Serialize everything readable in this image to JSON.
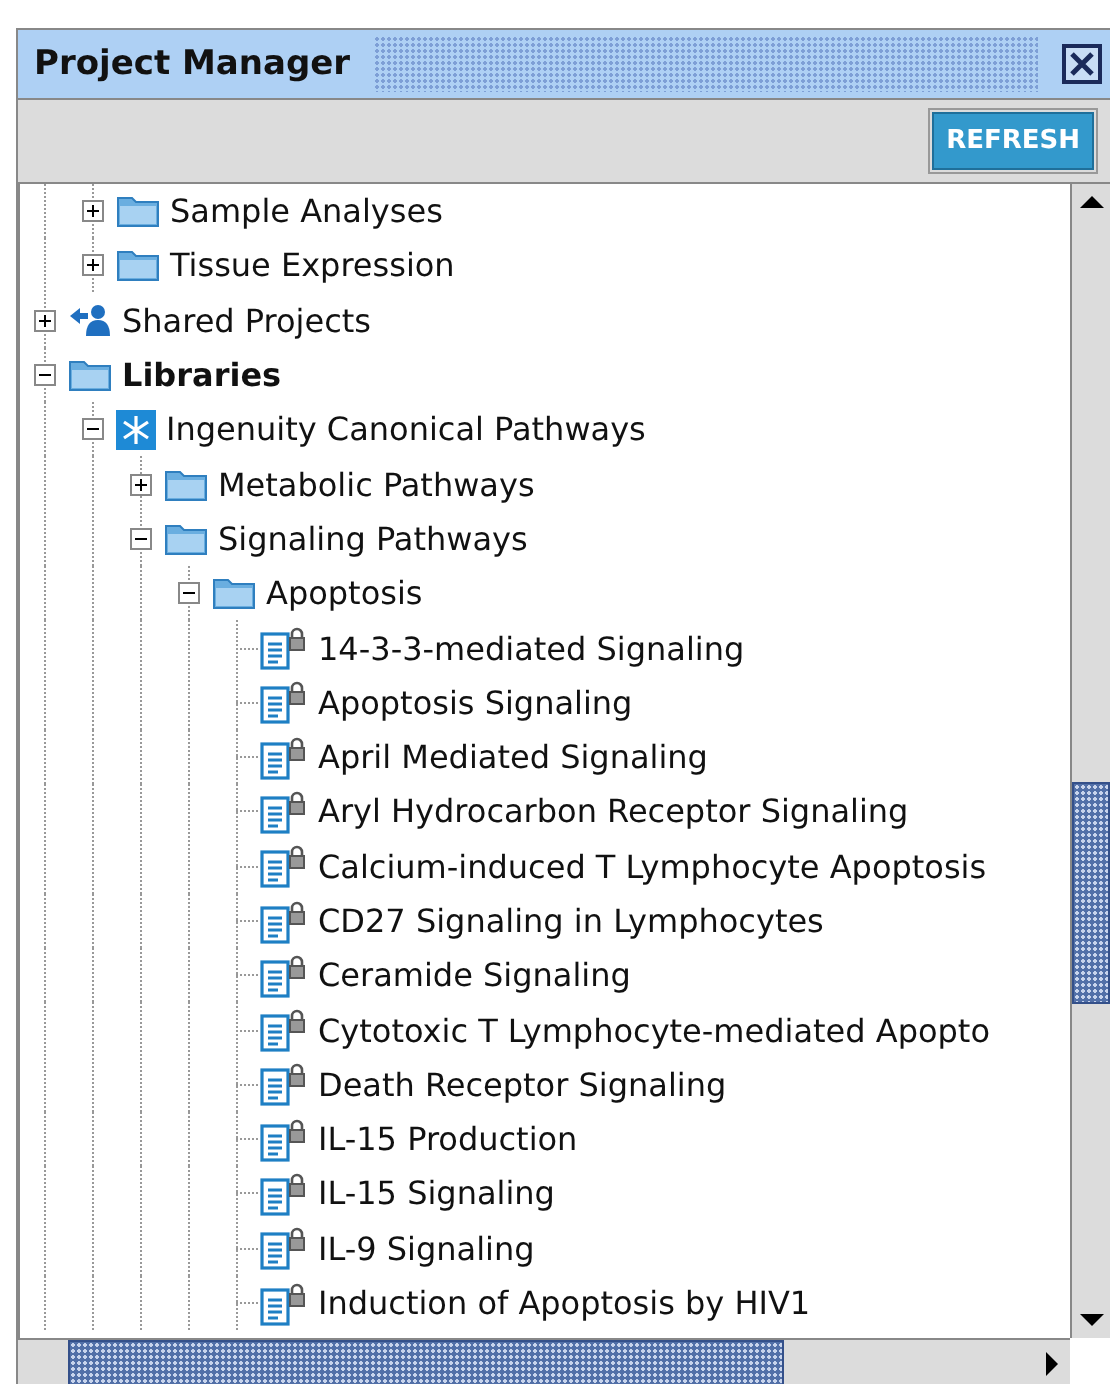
{
  "window": {
    "title": "Project Manager"
  },
  "toolbar": {
    "buttons": [
      "REFRESH"
    ]
  },
  "tree": [
    {
      "children": [
        {
          "label": "Sample Analyses",
          "kind": "folder",
          "expanded": false
        },
        {
          "label": "Tissue Expression",
          "kind": "folder",
          "expanded": false
        }
      ]
    },
    {
      "label": "Shared Projects",
      "kind": "shared",
      "expanded": false
    },
    {
      "label": "Libraries",
      "kind": "folder",
      "bold": true,
      "expanded": true,
      "children": [
        {
          "label": "Ingenuity Canonical Pathways",
          "kind": "canonical",
          "expanded": true,
          "children": [
            {
              "label": "Metabolic Pathways",
              "kind": "folder",
              "expanded": false
            },
            {
              "label": "Signaling Pathways",
              "kind": "folder",
              "expanded": true,
              "children": [
                {
                  "label": "Apoptosis",
                  "kind": "folder",
                  "expanded": true,
                  "children": [
                    {
                      "label": "14-3-3-mediated Signaling",
                      "kind": "pathway"
                    },
                    {
                      "label": "Apoptosis Signaling",
                      "kind": "pathway"
                    },
                    {
                      "label": "April Mediated Signaling",
                      "kind": "pathway"
                    },
                    {
                      "label": "Aryl Hydrocarbon Receptor Signaling",
                      "kind": "pathway"
                    },
                    {
                      "label": "Calcium-induced T Lymphocyte Apoptosis",
                      "kind": "pathway"
                    },
                    {
                      "label": "CD27 Signaling in Lymphocytes",
                      "kind": "pathway"
                    },
                    {
                      "label": "Ceramide Signaling",
                      "kind": "pathway"
                    },
                    {
                      "label": "Cytotoxic T Lymphocyte-mediated Apopto",
                      "kind": "pathway"
                    },
                    {
                      "label": "Death Receptor Signaling",
                      "kind": "pathway"
                    },
                    {
                      "label": "IL-15 Production",
                      "kind": "pathway"
                    },
                    {
                      "label": "IL-15 Signaling",
                      "kind": "pathway"
                    },
                    {
                      "label": "IL-9 Signaling",
                      "kind": "pathway"
                    },
                    {
                      "label": "Induction of Apoptosis by HIV1",
                      "kind": "pathway"
                    }
                  ]
                }
              ]
            }
          ]
        }
      ]
    }
  ]
}
